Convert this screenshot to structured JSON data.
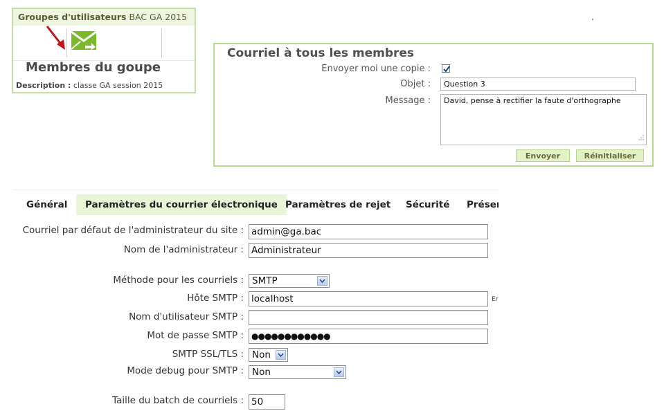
{
  "dot": ".",
  "group_card": {
    "header_bold": "Groupes d'utilisateurs",
    "header_name": "BAC GA 2015",
    "title": "Membres du goupe",
    "description_label": "Description :",
    "description_value": "classe GA session 2015",
    "icons": [
      "red-arrow-icon",
      "send-mail-icon"
    ]
  },
  "mail_panel": {
    "title": "Courriel à tous les membres",
    "copy_label": "Envoyer moi une copie :",
    "copy_checked": true,
    "subject_label": "Objet :",
    "subject_value": "Question 3",
    "message_label": "Message :",
    "message_value": "David, pense à rectifier la faute d'orthographe",
    "send_button": "Envoyer",
    "reset_button": "Réinitialiser",
    "colors": {
      "border": "#b9d98c",
      "button_bg": "#e2f1c6"
    }
  },
  "tabs": [
    {
      "label": "Général",
      "active": false
    },
    {
      "label": "Paramètres du courrier électronique",
      "active": true
    },
    {
      "label": "Paramètres de rejet",
      "active": false
    },
    {
      "label": "Sécurité",
      "active": false
    },
    {
      "label": "Préser",
      "active": false
    }
  ],
  "settings": {
    "admin_email_label": "Courriel par défaut de l'administrateur du site :",
    "admin_email_value": "admin@ga.bac",
    "admin_name_label": "Nom de l'administrateur :",
    "admin_name_value": "Administrateur",
    "method_label": "Méthode pour les courriels :",
    "method_value": "SMTP",
    "smtp_host_label": "Hôte SMTP :",
    "smtp_host_value": "localhost",
    "smtp_host_hint": "Er",
    "smtp_user_label": "Nom d'utilisateur SMTP :",
    "smtp_user_value": "",
    "smtp_pass_label": "Mot de passe SMTP :",
    "smtp_pass_value": "●●●●●●●●●●●●",
    "smtp_ssl_label": "SMTP SSL/TLS :",
    "smtp_ssl_value": "Non",
    "smtp_debug_label": "Mode debug pour SMTP :",
    "smtp_debug_value": "Non",
    "batch_label": "Taille du batch de courriels :",
    "batch_value": "50"
  }
}
